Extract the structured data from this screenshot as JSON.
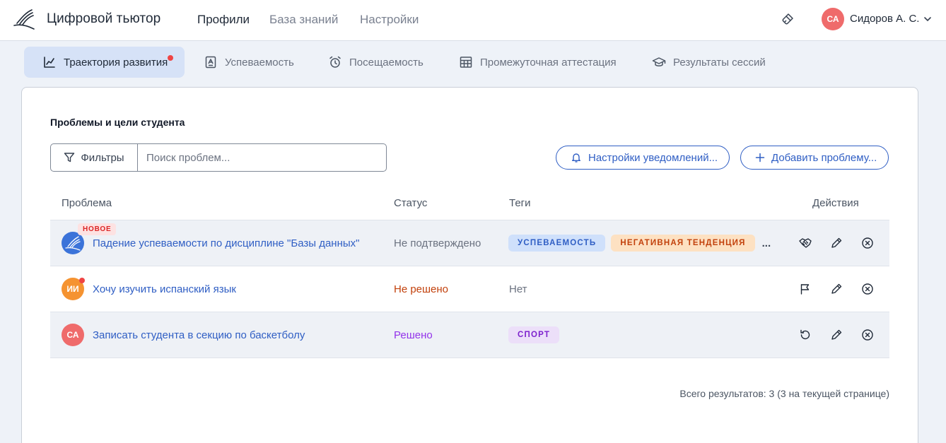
{
  "header": {
    "app_title": "Цифровой тьютор",
    "nav": [
      "Профили",
      "База знаний",
      "Настройки"
    ],
    "active_nav": 0,
    "user": {
      "initials": "СА",
      "name": "Сидоров А. С.",
      "avatar_color": "#ef6b6b"
    }
  },
  "tabs": [
    {
      "label": "Траектория развития",
      "icon": "chart-line-icon",
      "active": true,
      "has_dot": true
    },
    {
      "label": "Успеваемость",
      "icon": "grade-document-icon"
    },
    {
      "label": "Посещаемость",
      "icon": "alarm-clock-icon"
    },
    {
      "label": "Промежуточная аттестация",
      "icon": "table-grid-icon"
    },
    {
      "label": "Результаты сессий",
      "icon": "graduation-cap-icon"
    }
  ],
  "section": {
    "title": "Проблемы и цели студента",
    "filter_label": "Фильтры",
    "search_placeholder": "Поиск проблем...",
    "notify_button": "Настройки уведомлений...",
    "add_button": "Добавить проблему..."
  },
  "table": {
    "columns": [
      "Проблема",
      "Статус",
      "Теги",
      "Действия"
    ],
    "rows": [
      {
        "avatar": "logo",
        "badge": "НОВОЕ",
        "title": "Падение успеваемости по дисциплине \"Базы данных\"",
        "status": "Не подтверждено",
        "status_color": "#6b7280",
        "tags": [
          {
            "label": "Успеваемость",
            "bg": "#cfe0fb",
            "color": "#2f5ec4"
          },
          {
            "label": "Негативная тенденция",
            "bg": "#fde1c2",
            "color": "#c2410c"
          }
        ],
        "more": "...",
        "actions": [
          "handshake-icon",
          "pencil-icon",
          "close-circle-icon"
        ]
      },
      {
        "avatar_initials": "ИИ",
        "avatar_color": "#f59331",
        "has_dot": true,
        "title": "Хочу изучить испанский язык",
        "status": "Не решено",
        "status_color": "#c2410c",
        "tags_text": "Нет",
        "actions": [
          "flag-icon",
          "pencil-icon",
          "close-circle-icon"
        ]
      },
      {
        "avatar_initials": "СА",
        "avatar_color": "#ef6b6b",
        "title": "Записать студента в секцию по баскетболу",
        "status": "Решено",
        "status_color": "#9333ea",
        "tags": [
          {
            "label": "Спорт",
            "bg": "#ecdff9",
            "color": "#7e22ce"
          }
        ],
        "actions": [
          "undo-icon",
          "pencil-icon",
          "close-circle-icon"
        ]
      }
    ]
  },
  "total_text": "Всего результатов: 3 (3 на текущей странице)"
}
